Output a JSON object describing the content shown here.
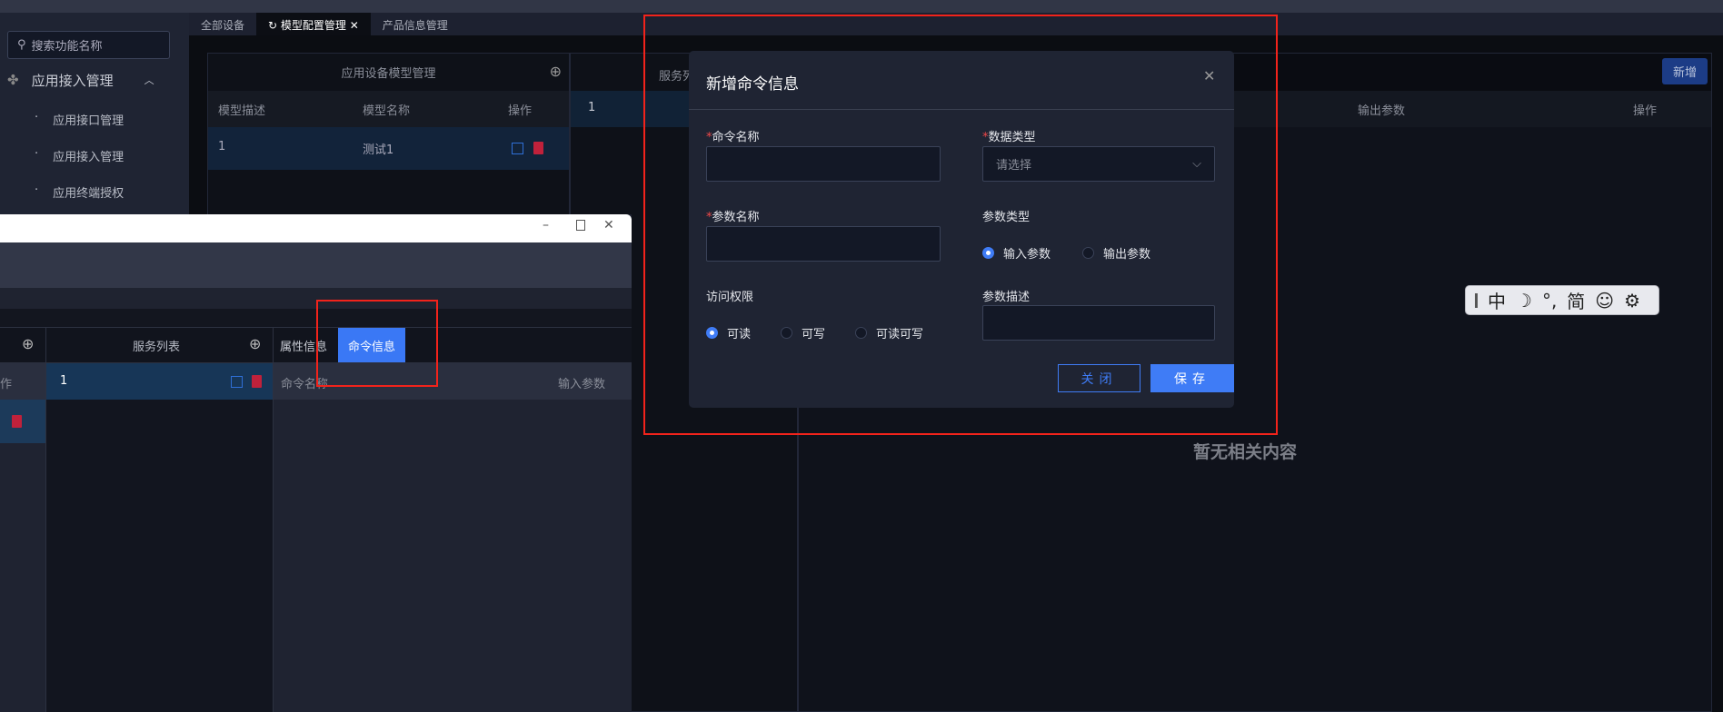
{
  "sidebar": {
    "search_placeholder": "搜索功能名称",
    "menu": "应用接入管理",
    "items": [
      "应用接口管理",
      "应用接入管理",
      "应用终端授权"
    ]
  },
  "tabs": [
    "全部设备",
    "模型配置管理",
    "产品信息管理"
  ],
  "panel1": {
    "title": "应用设备模型管理",
    "columns": [
      "模型描述",
      "模型名称",
      "操作"
    ],
    "rows": [
      {
        "desc": "1",
        "name": "测试1"
      }
    ]
  },
  "panel2": {
    "title": "服务列",
    "row": "1"
  },
  "panel3": {
    "add": "新增",
    "columns": [
      "输出参数",
      "操作"
    ],
    "empty": "暂无相关内容"
  },
  "dialog": {
    "title": "新增命令信息",
    "cmd_name": "命令名称",
    "data_type": "数据类型",
    "data_type_placeholder": "请选择",
    "param_name": "参数名称",
    "param_type": "参数类型",
    "param_type_options": [
      "输入参数",
      "输出参数"
    ],
    "access": "访问权限",
    "access_options": [
      "可读",
      "可写",
      "可读可写"
    ],
    "param_desc": "参数描述",
    "close": "关闭",
    "save": "保存",
    "required": "*"
  },
  "window": {
    "service_title": "服务列表",
    "first_col": "作",
    "row": "1",
    "tabs": [
      "属性信息",
      "命令信息"
    ],
    "columns": [
      "命令名称",
      "输入参数"
    ]
  },
  "ime": {
    "items": [
      "中",
      "°,",
      "简"
    ]
  }
}
